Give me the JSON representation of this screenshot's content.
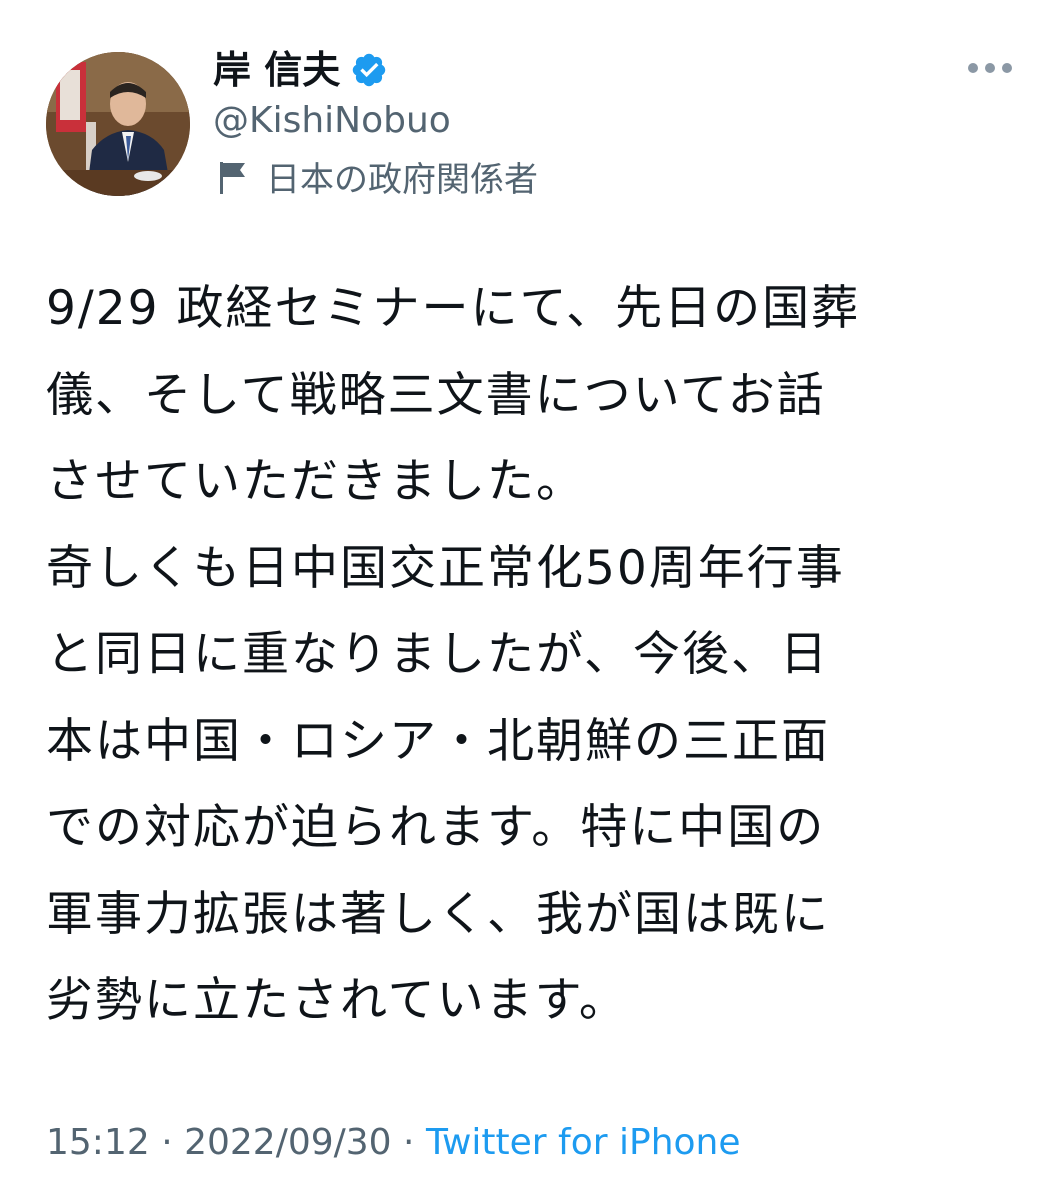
{
  "author": {
    "display_name": "岸 信夫",
    "handle": "@KishiNobuo",
    "label": "日本の政府関係者",
    "verified": true
  },
  "tweet": {
    "lines": [
      "9/29 政経セミナーにて、先日の国葬",
      "儀、そして戦略三文書についてお話",
      "させていただきました。",
      "奇しくも日中国交正常化50周年行事",
      "と同日に重なりましたが、今後、日",
      "本は中国・ロシア・北朝鮮の三正面",
      "での対応が迫られます。特に中国の",
      "軍事力拡張は著しく、我が国は既に",
      "劣勢に立たされています。"
    ]
  },
  "meta": {
    "time": "15:12",
    "separator": " · ",
    "date": "2022/09/30",
    "source": "Twitter for iPhone"
  },
  "colors": {
    "accent": "#1d9bf0",
    "text": "#0f1419",
    "secondary": "#536471"
  },
  "icons": {
    "verified": "verified-badge-icon",
    "label": "flag-icon",
    "more": "more-options-icon"
  }
}
